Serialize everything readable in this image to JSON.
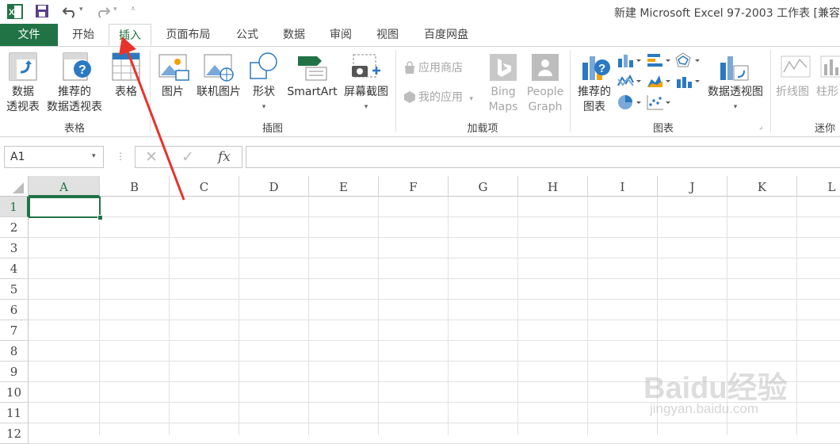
{
  "window": {
    "title": "新建 Microsoft Excel 97-2003 工作表  [兼容"
  },
  "tabs": [
    {
      "label": "文件"
    },
    {
      "label": "开始"
    },
    {
      "label": "插入"
    },
    {
      "label": "页面布局"
    },
    {
      "label": "公式"
    },
    {
      "label": "数据"
    },
    {
      "label": "审阅"
    },
    {
      "label": "视图"
    },
    {
      "label": "百度网盘"
    }
  ],
  "ribbon": {
    "tables": {
      "group_label": "表格",
      "pivot_line1": "数据",
      "pivot_line2": "透视表",
      "recpivot_line1": "推荐的",
      "recpivot_line2": "数据透视表",
      "table": "表格"
    },
    "illustrations": {
      "group_label": "插图",
      "pictures": "图片",
      "online_pictures": "联机图片",
      "shapes": "形状",
      "smartart": "SmartArt",
      "screenshot": "屏幕截图"
    },
    "addins": {
      "group_label": "加载项",
      "store": "应用商店",
      "my_apps": "我的应用",
      "bing_line1": "Bing",
      "bing_line2": "Maps",
      "people_line1": "People",
      "people_line2": "Graph"
    },
    "charts": {
      "group_label": "图表",
      "rec_line1": "推荐的",
      "rec_line2": "图表",
      "pivotchart": "数据透视图"
    },
    "sparklines": {
      "group_label": "迷你",
      "line": "折线图",
      "column": "柱形"
    }
  },
  "formula_bar": {
    "name_box": "A1",
    "fx": "fx",
    "value": ""
  },
  "grid": {
    "columns": [
      "A",
      "B",
      "C",
      "D",
      "E",
      "F",
      "G",
      "H",
      "I",
      "J",
      "K",
      "L"
    ],
    "rows": [
      "1",
      "2",
      "3",
      "4",
      "5",
      "6",
      "7",
      "8",
      "9",
      "10",
      "11",
      "12"
    ],
    "selected_cell": "A1"
  },
  "watermark": {
    "text": "Baidu经验",
    "url": "jingyan.baidu.com"
  },
  "colors": {
    "accent": "#217346",
    "arrow": "#e8322a"
  }
}
